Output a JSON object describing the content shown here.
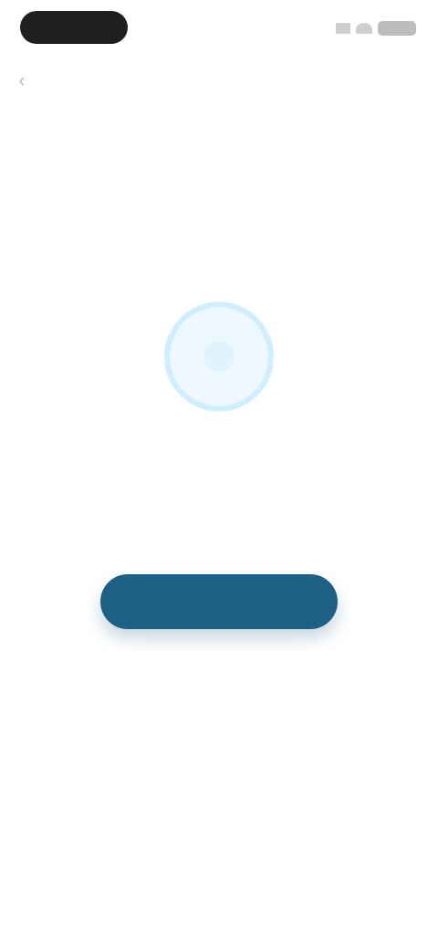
{
  "status_bar": {
    "icons": [
      "signal-icon",
      "wifi-icon",
      "battery-icon"
    ]
  },
  "header": {
    "title": "",
    "back_icon": "chevron-left-icon"
  },
  "empty_state": {
    "title": "",
    "description": "",
    "illustration_icon": "empty-state-icon"
  },
  "cta": {
    "label": ""
  },
  "colors": {
    "primary": "#1e5f86",
    "light_circle": "#cfeeff"
  }
}
